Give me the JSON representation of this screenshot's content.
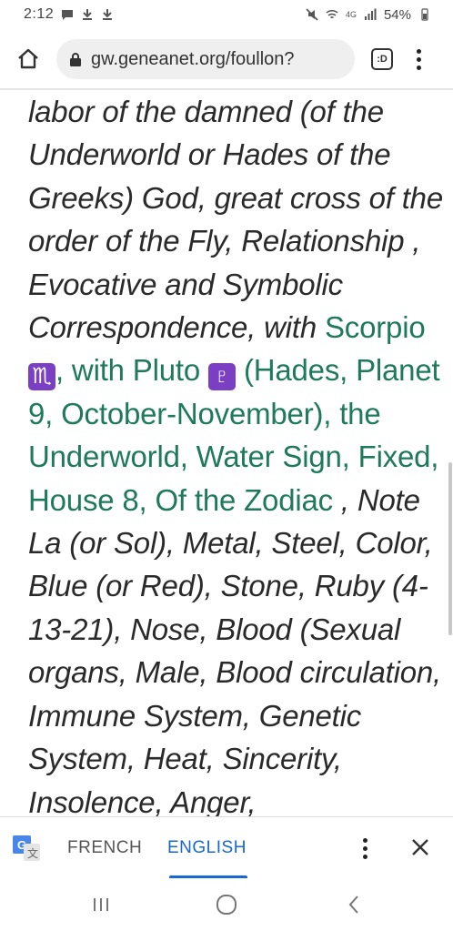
{
  "status_bar": {
    "time": "2:12",
    "network": "4G",
    "battery": "54%",
    "icons": [
      "message-icon",
      "download-icon",
      "download-icon",
      "mute-icon",
      "wifi-icon",
      "signal-icon",
      "battery-icon"
    ]
  },
  "browser": {
    "url": "gw.geneanet.org/foullon?",
    "tabs_label": ":D"
  },
  "article": {
    "segments": [
      {
        "text": "labor of the damned (of the Underworld or Hades of the Greeks) God, great cross of the order of the Fly, Relationship , Evocative and Symbolic Correspondence, with ",
        "link": false
      },
      {
        "text": "Scorpio ",
        "link": true
      },
      {
        "text": "♏",
        "link": true,
        "badge": true
      },
      {
        "text": ", with Pluto ",
        "link": true
      },
      {
        "text": "♇",
        "link": true,
        "badge": true
      },
      {
        "text": " (Hades, Planet 9, October-November), the Underworld, Water Sign, Fixed, House 8, Of the Zodiac",
        "link": true
      },
      {
        "text": " , Note La (or Sol), Metal, Steel, Color, Blue (or Red), Stone, Ruby (4-13-21), Nose, Blood (Sexual organs, Male, Blood circulation, Immune System, Genetic System, Heat, Sincerity, Insolence, Anger,",
        "link": false
      }
    ]
  },
  "translate_bar": {
    "source_lang": "FRENCH",
    "target_lang": "ENGLISH",
    "selected": "ENGLISH"
  },
  "colors": {
    "link": "#1e7a5a",
    "accent": "#1a66d2",
    "zodiac_badge": "#7b3fc4"
  }
}
